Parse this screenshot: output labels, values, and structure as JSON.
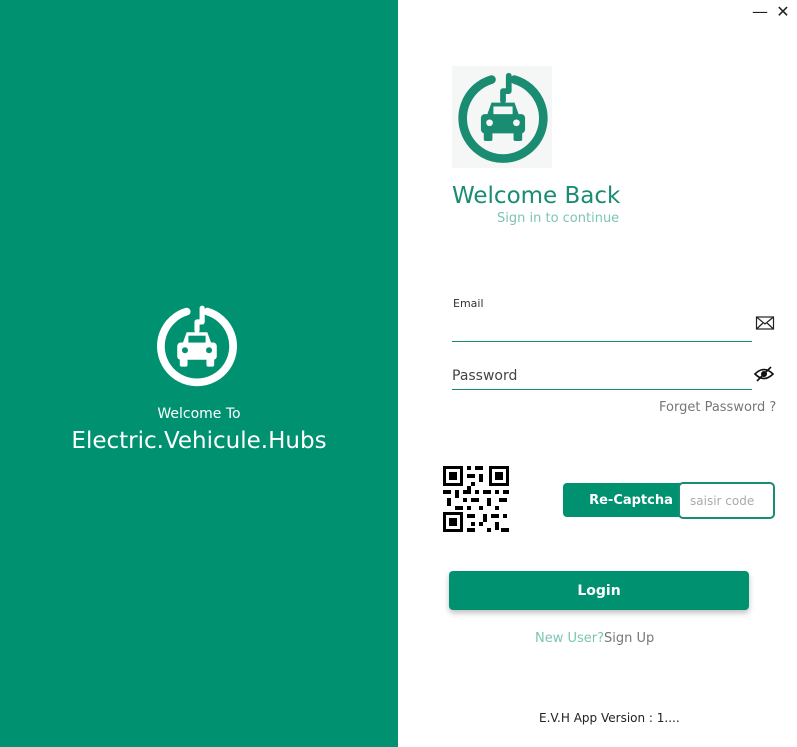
{
  "window": {
    "minimize": "—",
    "close": "✕"
  },
  "left_panel": {
    "welcome_to": "Welcome To",
    "app_name": "Electric.Vehicule.Hubs",
    "logo_icon": "ev-car-plug-icon"
  },
  "header": {
    "title": "Welcome Back",
    "subtitle": "Sign in to continue",
    "logo_icon": "ev-car-plug-icon"
  },
  "form": {
    "email_label": "Email",
    "email_value": "",
    "email_icon": "envelope-icon",
    "password_placeholder": "Password",
    "password_icon": "eye-slash-icon",
    "forgot_password": "Forget Password ?"
  },
  "captcha": {
    "qr_icon": "qr-code-icon",
    "recaptcha_label": "Re-Captcha",
    "code_placeholder": "saisir code"
  },
  "actions": {
    "login_label": "Login",
    "new_user": "New User?",
    "sign_up": "Sign Up"
  },
  "footer": {
    "version": "E.V.H App Version : 1...."
  },
  "colors": {
    "brand": "#009270",
    "accent_text": "#1a8c72",
    "muted_accent": "#7cc5b3"
  }
}
